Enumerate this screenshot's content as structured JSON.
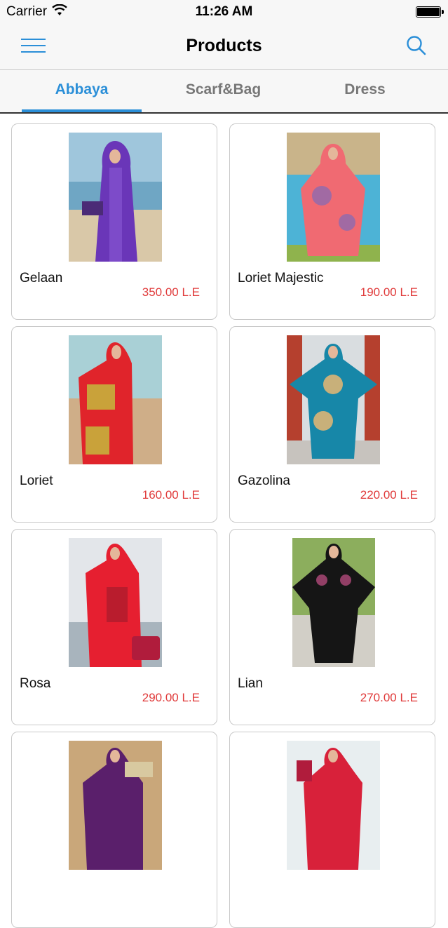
{
  "status_bar": {
    "carrier": "Carrier",
    "time": "11:26 AM"
  },
  "nav": {
    "title": "Products",
    "menu_icon": "hamburger-menu-icon",
    "search_icon": "search-icon"
  },
  "tabs": [
    {
      "label": "Abbaya",
      "active": true
    },
    {
      "label": "Scarf&Bag",
      "active": false
    },
    {
      "label": "Dress",
      "active": false
    }
  ],
  "colors": {
    "accent": "#2b8fd8",
    "price": "#e03a3a"
  },
  "products": [
    {
      "name": "Gelaan",
      "price": "350.00 L.E"
    },
    {
      "name": "Loriet Majestic",
      "price": "190.00 L.E"
    },
    {
      "name": "Loriet",
      "price": "160.00 L.E"
    },
    {
      "name": "Gazolina",
      "price": "220.00 L.E"
    },
    {
      "name": "Rosa",
      "price": "290.00 L.E"
    },
    {
      "name": "Lian",
      "price": "270.00 L.E"
    },
    {
      "name": "",
      "price": ""
    },
    {
      "name": "",
      "price": ""
    }
  ]
}
